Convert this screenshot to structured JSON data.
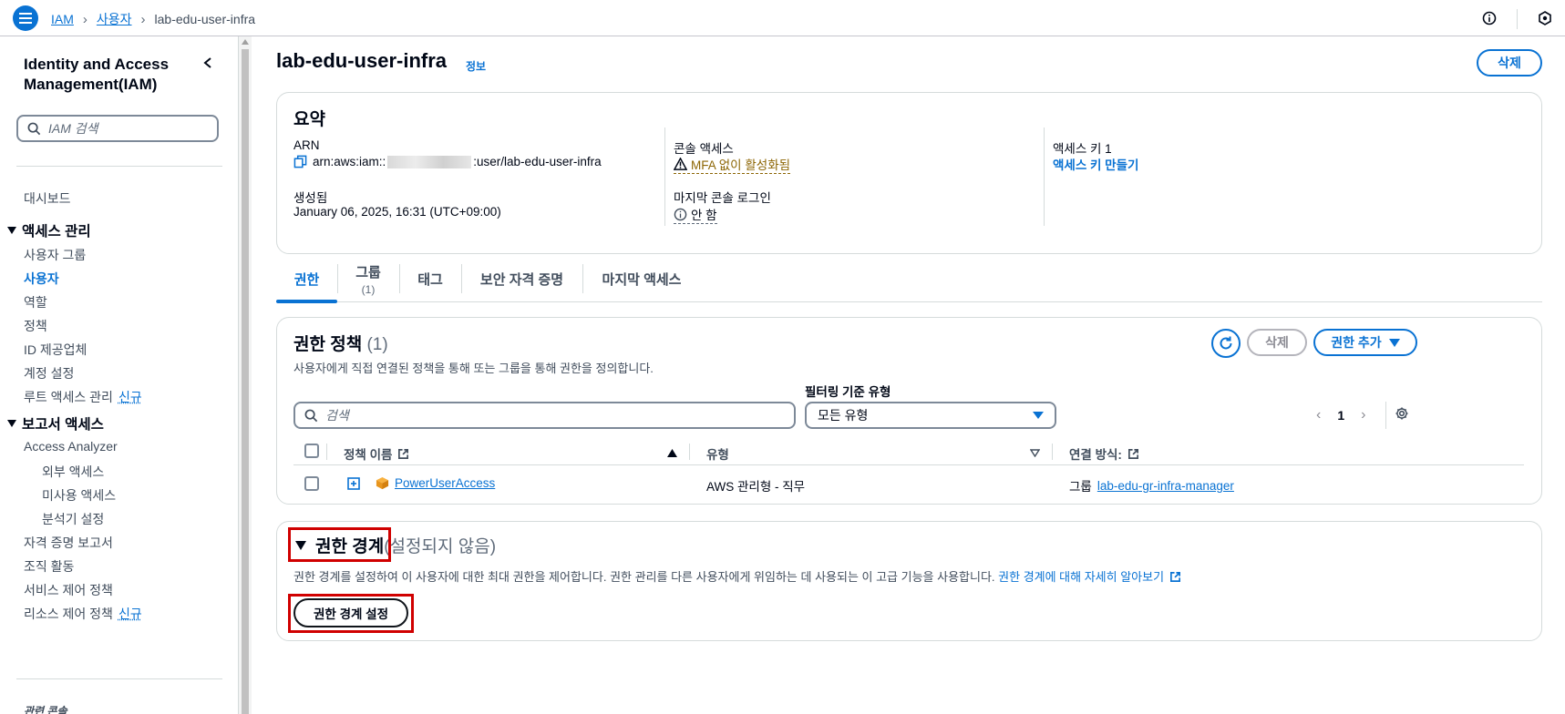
{
  "topbar": {
    "breadcrumb": [
      "IAM",
      "사용자",
      "lab-edu-user-infra"
    ]
  },
  "sidebar": {
    "title": "Identity and Access Management(IAM)",
    "search_placeholder": "IAM 검색",
    "dashboard": "대시보드",
    "access_mgmt": {
      "label": "액세스 관리",
      "items": [
        "사용자 그룹",
        "사용자",
        "역할",
        "정책",
        "ID 제공업체",
        "계정 설정",
        "루트 액세스 관리"
      ],
      "new_badge": "신규"
    },
    "reports": {
      "label": "보고서 액세스",
      "analyzer": "Access Analyzer",
      "sub_items": [
        "외부 액세스",
        "미사용 액세스",
        "분석기 설정"
      ],
      "items": [
        "자격 증명 보고서",
        "조직 활동",
        "서비스 제어 정책",
        "리소스 제어 정책"
      ],
      "new_badge": "신규"
    },
    "related": "관련 콘솔"
  },
  "page": {
    "title": "lab-edu-user-infra",
    "info": "정보",
    "delete_button": "삭제"
  },
  "summary": {
    "heading": "요약",
    "arn_label": "ARN",
    "arn_prefix": "arn:aws:iam::",
    "arn_suffix": ":user/lab-edu-user-infra",
    "created_label": "생성됨",
    "created_value": "January 06, 2025, 16:31 (UTC+09:00)",
    "console_label": "콘솔 액세스",
    "console_value": "MFA 없이 활성화됨",
    "last_login_label": "마지막 콘솔 로그인",
    "last_login_value": "안 함",
    "access_key_label": "액세스 키 1",
    "access_key_value": "액세스 키 만들기"
  },
  "tabs": [
    {
      "label": "권한",
      "sub": ""
    },
    {
      "label": "그룹",
      "sub": "(1)"
    },
    {
      "label": "태그",
      "sub": ""
    },
    {
      "label": "보안 자격 증명",
      "sub": ""
    },
    {
      "label": "마지막 액세스",
      "sub": ""
    }
  ],
  "permissions": {
    "heading": "권한 정책",
    "count": "(1)",
    "description": "사용자에게 직접 연결된 정책을 통해 또는 그룹을 통해 권한을 정의합니다.",
    "delete_button": "삭제",
    "add_button": "권한 추가",
    "search_placeholder": "검색",
    "filter_label": "필터링 기준 유형",
    "filter_value": "모든 유형",
    "page": "1",
    "columns": [
      "정책 이름",
      "유형",
      "연결 방식:"
    ],
    "rows": [
      {
        "name": "PowerUserAccess",
        "type": "AWS 관리형 - 직무",
        "attach_prefix": "그룹",
        "attach_link": "lab-edu-gr-infra-manager"
      }
    ]
  },
  "boundary": {
    "heading": "권한 경계",
    "note": "(설정되지 않음)",
    "description": "권한 경계를 설정하여 이 사용자에 대한 최대 권한을 제어합니다. 권한 관리를 다른 사용자에게 위임하는 데 사용되는 이 고급 기능을 사용합니다.",
    "learn_more": "권한 경계에 대해 자세히 알아보기",
    "set_button": "권한 경계 설정"
  },
  "colors": {
    "accent": "#0972d3",
    "warning": "#8d6605",
    "highlight": "#d00000"
  }
}
